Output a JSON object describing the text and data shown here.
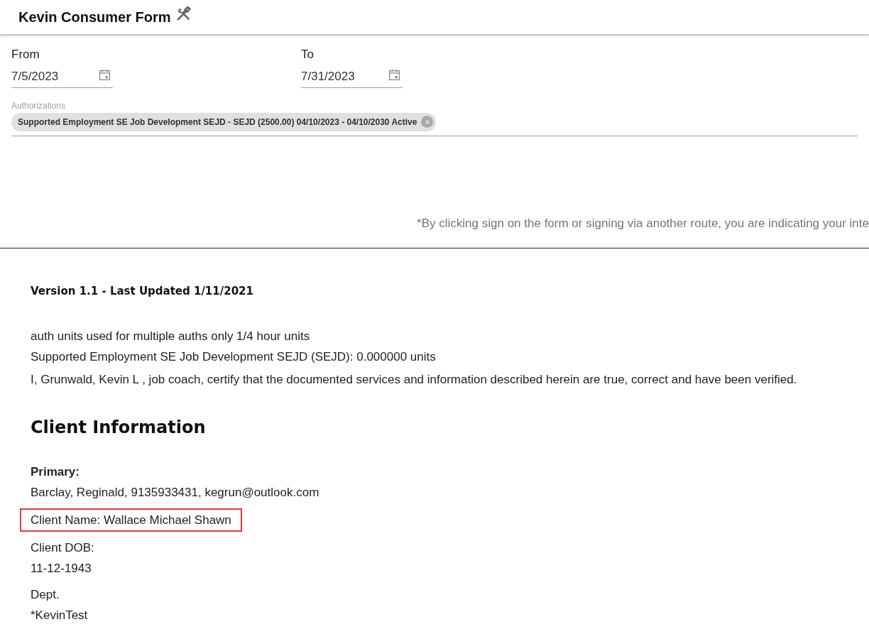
{
  "header": {
    "title": "Kevin Consumer Form"
  },
  "dates": [
    {
      "label": "From",
      "value": "7/5/2023"
    },
    {
      "label": "To",
      "value": "7/31/2023"
    }
  ],
  "authorizations": {
    "label": "Authorizations",
    "chips": [
      {
        "text": "Supported Employment SE Job Development SEJD - SEJD (2500.00) 04/10/2023 - 04/10/2030 Active"
      }
    ]
  },
  "disclaimer": "*By clicking sign on the form or signing via another route, you are indicating your inte",
  "document": {
    "version": "Version 1.1 - Last Updated 1/11/2021",
    "notes": [
      "auth units used for multiple auths only 1/4 hour units",
      "Supported Employment SE Job Development SEJD (SEJD): 0.000000 units"
    ],
    "certification": "I, Grunwald, Kevin L , job coach, certify that the documented services and information described herein are true, correct and have been verified.",
    "section_title": "Client Information",
    "fields": [
      {
        "kind": "stacked",
        "label": "Primary:",
        "bold": true,
        "value": "Barclay, Reginald, 9135933431, kegrun@outlook.com",
        "highlighted": false
      },
      {
        "kind": "inline",
        "text": "Client Name: Wallace Michael Shawn",
        "highlighted": true
      },
      {
        "kind": "stacked",
        "label": "Client DOB:",
        "bold": false,
        "value": "11-12-1943",
        "highlighted": false
      },
      {
        "kind": "stacked",
        "label": "Dept.",
        "bold": false,
        "value": "*KevinTest",
        "highlighted": false
      }
    ]
  }
}
